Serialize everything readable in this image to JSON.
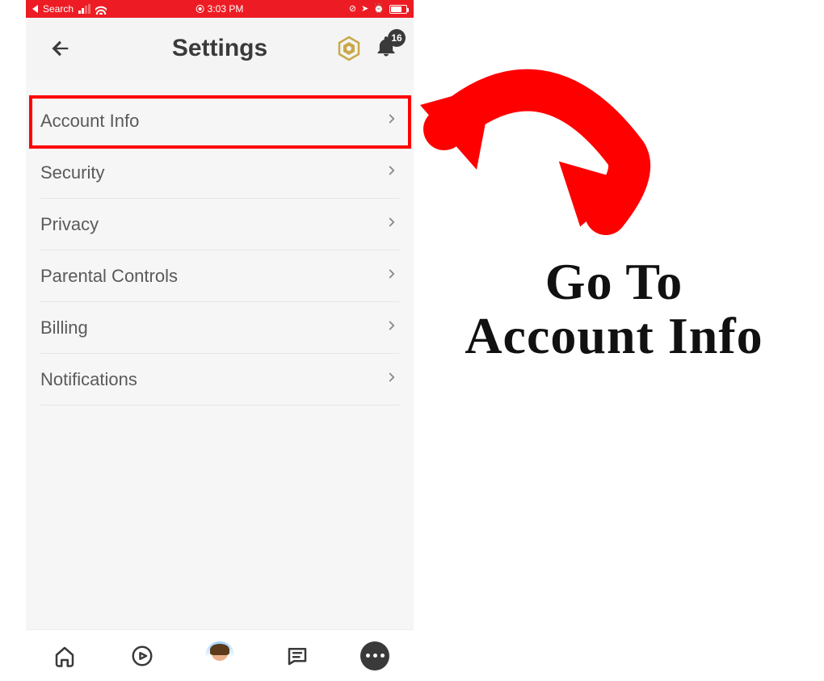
{
  "status_bar": {
    "back_label": "Search",
    "time": "3:03 PM"
  },
  "header": {
    "title": "Settings",
    "notification_count": "16"
  },
  "settings_items": [
    {
      "label": "Account Info"
    },
    {
      "label": "Security"
    },
    {
      "label": "Privacy"
    },
    {
      "label": "Parental Controls"
    },
    {
      "label": "Billing"
    },
    {
      "label": "Notifications"
    }
  ],
  "annotation": {
    "line1": "Go To",
    "line2": "Account Info"
  },
  "colors": {
    "highlight": "#ff0000",
    "status_bg": "#ed1c24"
  }
}
